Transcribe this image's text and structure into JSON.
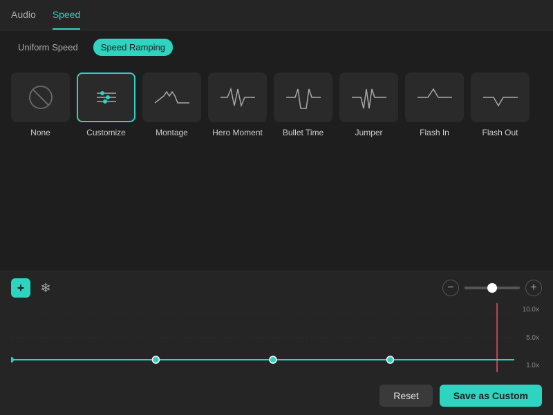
{
  "tabs": [
    {
      "id": "audio",
      "label": "Audio",
      "active": false
    },
    {
      "id": "speed",
      "label": "Speed",
      "active": true
    }
  ],
  "subTabs": [
    {
      "id": "uniform",
      "label": "Uniform Speed",
      "active": false
    },
    {
      "id": "ramping",
      "label": "Speed Ramping",
      "active": true
    }
  ],
  "presets": [
    {
      "id": "none",
      "label": "None",
      "icon": "none",
      "selected": false
    },
    {
      "id": "customize",
      "label": "Customize",
      "icon": "customize",
      "selected": true
    },
    {
      "id": "montage",
      "label": "Montage",
      "icon": "montage",
      "selected": false
    },
    {
      "id": "hero-moment",
      "label": "Hero Moment",
      "icon": "hero",
      "selected": false
    },
    {
      "id": "bullet-time",
      "label": "Bullet Time",
      "icon": "bullet",
      "selected": false
    },
    {
      "id": "jumper",
      "label": "Jumper",
      "icon": "jumper",
      "selected": false
    },
    {
      "id": "flash-in",
      "label": "Flash In",
      "icon": "flashin",
      "selected": false
    },
    {
      "id": "flash-out",
      "label": "Flash Out",
      "icon": "flashout",
      "selected": false
    }
  ],
  "timeline": {
    "add_label": "+",
    "zoom_minus": "−",
    "zoom_plus": "+",
    "graph_labels": [
      "10.0x",
      "5.0x",
      "1.0x"
    ]
  },
  "buttons": {
    "reset": "Reset",
    "save_custom": "Save as Custom"
  }
}
